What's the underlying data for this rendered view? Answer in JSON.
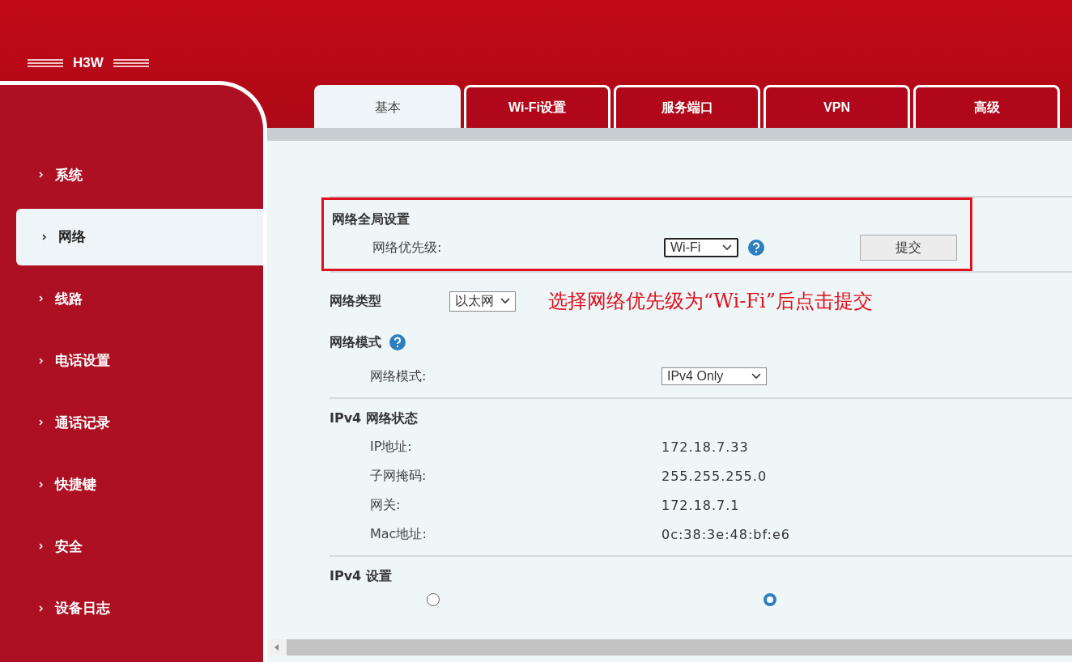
{
  "logo": "H3W",
  "sidebar": {
    "items": [
      {
        "label": "系统",
        "selected": false
      },
      {
        "label": "网络",
        "selected": true
      },
      {
        "label": "线路",
        "selected": false
      },
      {
        "label": "电话设置",
        "selected": false
      },
      {
        "label": "通话记录",
        "selected": false
      },
      {
        "label": "快捷键",
        "selected": false
      },
      {
        "label": "安全",
        "selected": false
      },
      {
        "label": "设备日志",
        "selected": false
      }
    ]
  },
  "tabs": [
    {
      "label": "基本",
      "selected": true
    },
    {
      "label": "Wi-Fi设置",
      "selected": false
    },
    {
      "label": "服务端口",
      "selected": false
    },
    {
      "label": "VPN",
      "selected": false
    },
    {
      "label": "高级",
      "selected": false
    }
  ],
  "global_settings": {
    "title": "网络全局设置",
    "priority_label": "网络优先级:",
    "priority_value": "Wi-Fi",
    "submit": "提交",
    "highlighted": true
  },
  "annotation": "选择网络优先级为“Wi-Fi”后点击提交",
  "network_type": {
    "label": "网络类型",
    "value": "以太网"
  },
  "network_mode": {
    "title": "网络模式",
    "label": "网络模式:",
    "value": "IPv4 Only"
  },
  "ipv4_status": {
    "title": "IPv4 网络状态",
    "rows": [
      {
        "label": "IP地址:",
        "value": "172.18.7.33"
      },
      {
        "label": "子网掩码:",
        "value": "255.255.255.0"
      },
      {
        "label": "网关:",
        "value": "172.18.7.1"
      },
      {
        "label": "Mac地址:",
        "value": "0c:38:3e:48:bf:e6"
      }
    ]
  },
  "ipv4_settings": {
    "title": "IPv4 设置",
    "radios": [
      {
        "selected": false
      },
      {
        "selected": true
      }
    ]
  }
}
